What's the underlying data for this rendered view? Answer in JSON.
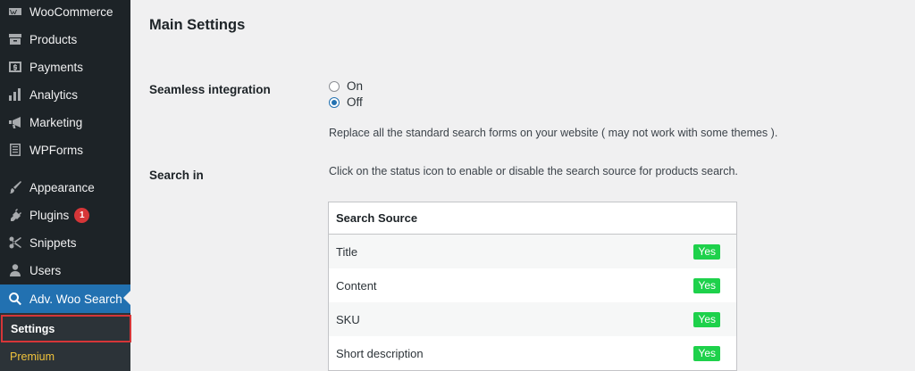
{
  "sidebar": {
    "items": [
      {
        "label": "WooCommerce",
        "icon": "woocommerce-icon"
      },
      {
        "label": "Products",
        "icon": "archive-icon"
      },
      {
        "label": "Payments",
        "icon": "dollar-icon"
      },
      {
        "label": "Analytics",
        "icon": "bar-chart-icon"
      },
      {
        "label": "Marketing",
        "icon": "megaphone-icon"
      },
      {
        "label": "WPForms",
        "icon": "form-icon"
      },
      {
        "label": "Appearance",
        "icon": "paintbrush-icon"
      },
      {
        "label": "Plugins",
        "icon": "plug-icon",
        "badge": "1"
      },
      {
        "label": "Snippets",
        "icon": "scissors-icon"
      },
      {
        "label": "Users",
        "icon": "user-icon"
      },
      {
        "label": "Adv. Woo Search",
        "icon": "search-icon"
      }
    ],
    "submenu": {
      "settings": "Settings",
      "premium": "Premium"
    }
  },
  "main": {
    "title": "Main Settings",
    "seamless": {
      "label": "Seamless integration",
      "options": [
        "On",
        "Off"
      ],
      "selected": "Off",
      "description": "Replace all the standard search forms on your website ( may not work with some themes )."
    },
    "search_in": {
      "label": "Search in",
      "description": "Click on the status icon to enable or disable the search source for products search.",
      "table_header": "Search Source",
      "rows": [
        {
          "source": "Title",
          "status": "Yes"
        },
        {
          "source": "Content",
          "status": "Yes"
        },
        {
          "source": "SKU",
          "status": "Yes"
        },
        {
          "source": "Short description",
          "status": "Yes"
        }
      ]
    }
  },
  "colors": {
    "sidebar_bg": "#1d2327",
    "active_bg": "#2271b1",
    "badge": "#d63638",
    "status_yes": "#1ed14b",
    "premium": "#f0c33c"
  }
}
